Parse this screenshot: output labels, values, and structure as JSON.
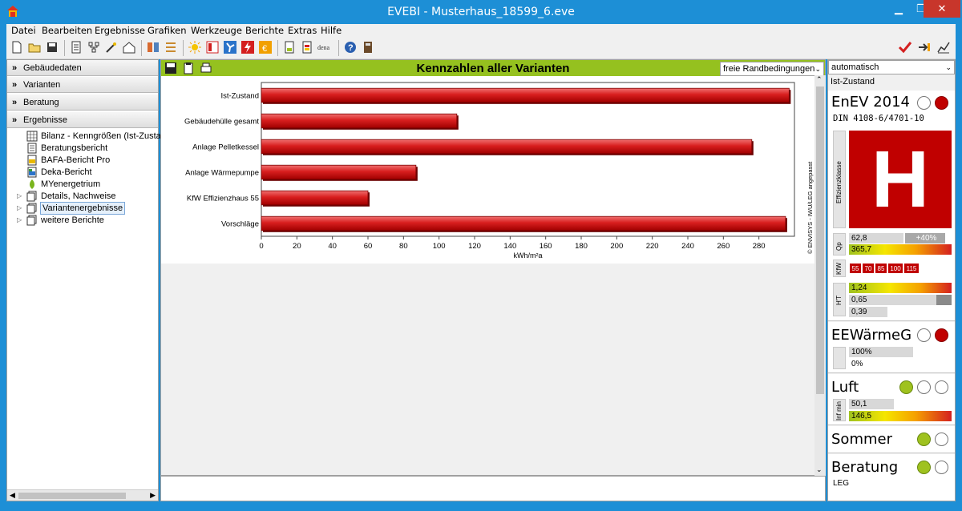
{
  "window": {
    "title": "EVEBI - Musterhaus_18599_6.eve"
  },
  "menu": [
    "Datei",
    "Bearbeiten",
    "Ergebnisse",
    "Grafiken",
    "Werkzeuge",
    "Berichte",
    "Extras",
    "Hilfe"
  ],
  "left_panel": {
    "sections": [
      "Gebäudedaten",
      "Varianten",
      "Beratung",
      "Ergebnisse"
    ],
    "tree": [
      {
        "label": "Bilanz - Kenngrößen (Ist-Zustan"
      },
      {
        "label": "Beratungsbericht"
      },
      {
        "label": "BAFA-Bericht Pro"
      },
      {
        "label": "Deka-Bericht"
      },
      {
        "label": "MYenergetrium"
      },
      {
        "label": "Details, Nachweise"
      },
      {
        "label": "Variantenergebnisse"
      },
      {
        "label": "weitere Berichte"
      }
    ]
  },
  "main": {
    "title": "Kennzahlen aller Varianten",
    "dropdown": "freie Randbedingungen",
    "copyright": "© ENVISYS - IWU/LEG angepasst"
  },
  "chart_data": {
    "type": "bar",
    "orientation": "horizontal",
    "categories": [
      "Ist-Zustand",
      "Gebäudehülle gesamt",
      "Anlage Pelletkessel",
      "Anlage Wärmepumpe",
      "KfW Effizienzhaus 55",
      "Vorschläge"
    ],
    "values": [
      297,
      110,
      276,
      87,
      60,
      295
    ],
    "xlabel": "kWh/m²a",
    "xlim": [
      0,
      300
    ],
    "ticks": [
      0,
      20,
      40,
      60,
      80,
      100,
      120,
      140,
      160,
      180,
      200,
      220,
      240,
      260,
      280
    ],
    "bar_color": "#d81e1e"
  },
  "right_panel": {
    "mode": "automatisch",
    "variant": "Ist-Zustand",
    "enev": {
      "title": "EnEV 2014",
      "subtitle": "DIN 4108-6/4701-10",
      "class_label": "Effizienzklasse",
      "class": "H",
      "qp_label": "Qp",
      "qp_value1": "62,8",
      "qp_delta": "+40%",
      "qp_value2": "365,7",
      "kfw_label": "KfW",
      "kfw_levels": [
        "55",
        "70",
        "85",
        "100",
        "115"
      ],
      "ht_label": "H'T",
      "ht_values": [
        "1,24",
        "0,65",
        "0,39"
      ]
    },
    "ee": {
      "title": "EEWärmeG",
      "values": [
        "100%",
        "0%"
      ]
    },
    "luft": {
      "title": "Luft",
      "label": "Inf min",
      "values": [
        "50,1",
        "146,5"
      ]
    },
    "sommer": {
      "title": "Sommer"
    },
    "beratung": {
      "title": "Beratung",
      "sub": "LEG"
    }
  },
  "colors": {
    "accent_green": "#95c11f",
    "titlebar_blue": "#1d8fd6",
    "class_red": "#c00000"
  }
}
